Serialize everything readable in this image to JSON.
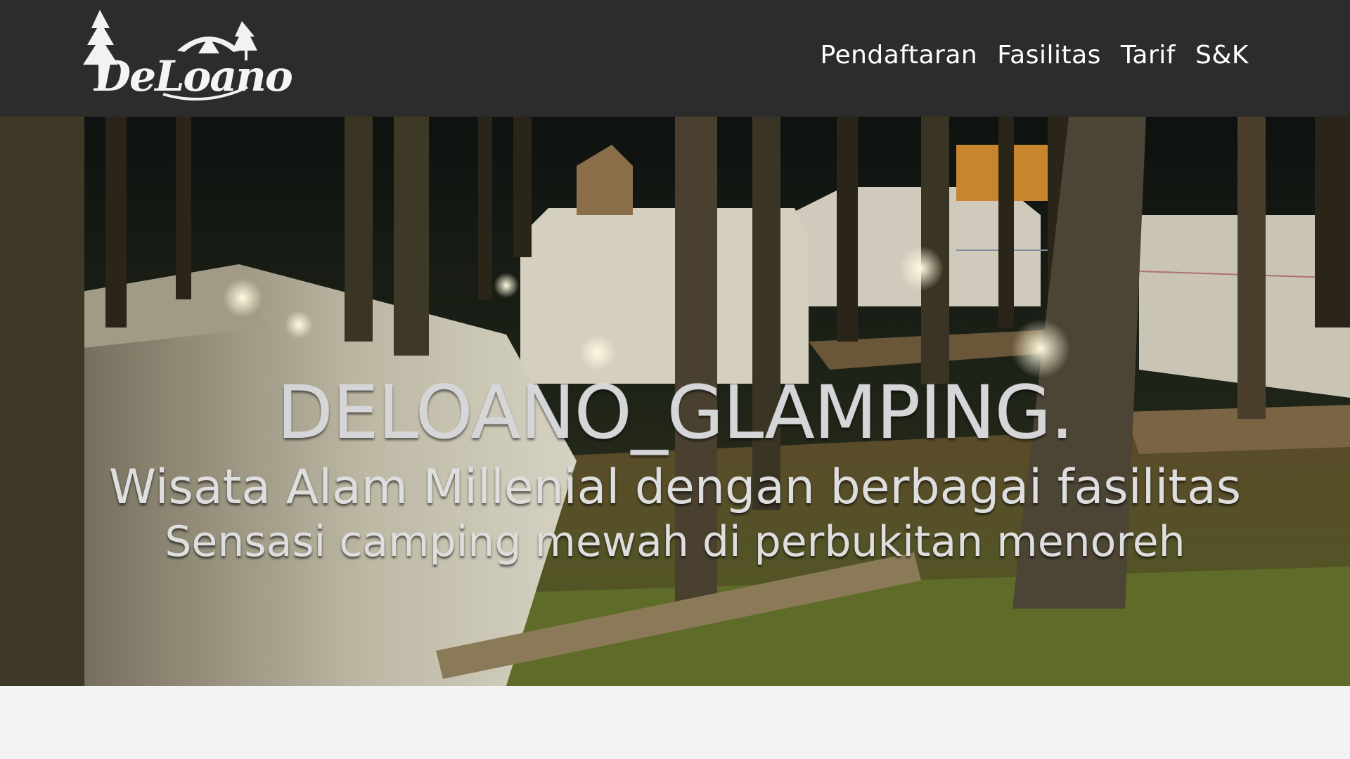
{
  "brand": {
    "logo_text": "DeLoano",
    "icon": "tree-tent-logo-icon"
  },
  "nav": {
    "items": [
      {
        "label": "Pendaftaran"
      },
      {
        "label": "Fasilitas"
      },
      {
        "label": "Tarif"
      },
      {
        "label": "S&K"
      }
    ]
  },
  "hero": {
    "title": "DELOANO_GLAMPING.",
    "subtitle_1": "Wisata Alam Millenial dengan berbagai fasilitas",
    "subtitle_2": "Sensasi camping mewah di perbukitan menoreh"
  },
  "colors": {
    "navbar_bg": "#2c2c2c",
    "nav_text": "#ffffff",
    "page_bg": "#f3f3f3"
  }
}
